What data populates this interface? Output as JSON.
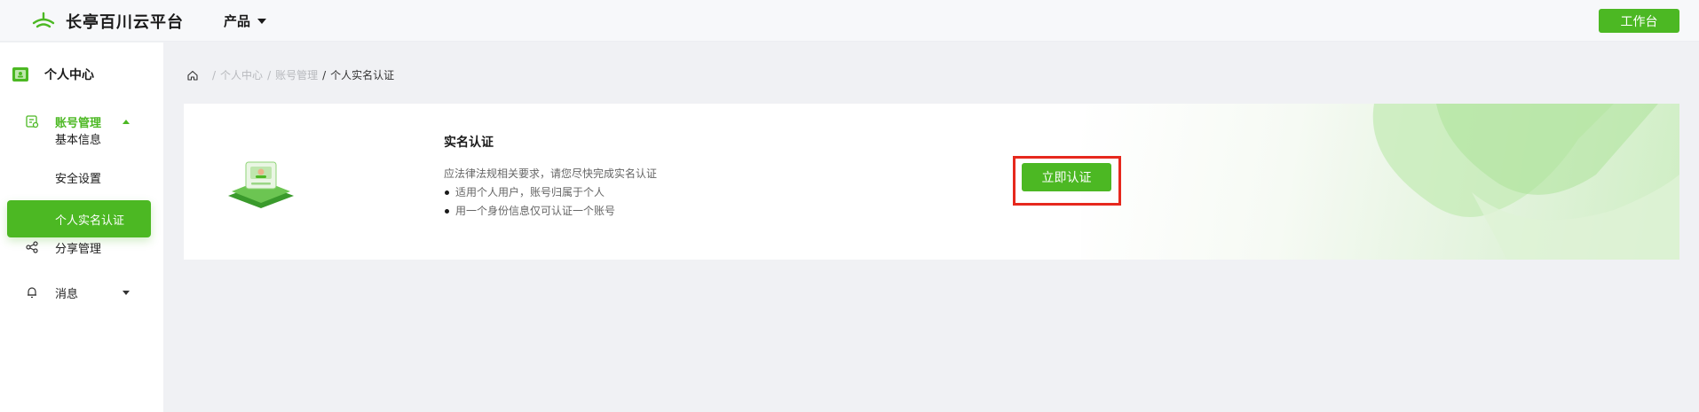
{
  "topbar": {
    "brand": "长亭百川云平台",
    "product_menu": "产品",
    "workbench_button": "工作台",
    "accent_color": "#4cb823"
  },
  "sidebar": {
    "header_title": "个人中心",
    "groups": [
      {
        "label": "账号管理",
        "icon": "account-icon",
        "expanded": true
      },
      {
        "label": "分享管理",
        "icon": "share-icon"
      },
      {
        "label": "消息",
        "icon": "bell-icon",
        "expanded": false
      }
    ],
    "sub_items": [
      "基本信息",
      "安全设置",
      "个人实名认证"
    ],
    "active_item": "个人实名认证"
  },
  "breadcrumb": {
    "items": [
      "个人中心",
      "账号管理"
    ],
    "current": "个人实名认证"
  },
  "card": {
    "title": "实名认证",
    "description": "应法律法规相关要求，请您尽快完成实名认证",
    "bullets": [
      "适用个人用户，账号归属于个人",
      "用一个身份信息仅可认证一个账号"
    ],
    "verify_button": "立即认证",
    "highlight_color": "#e6281d"
  }
}
